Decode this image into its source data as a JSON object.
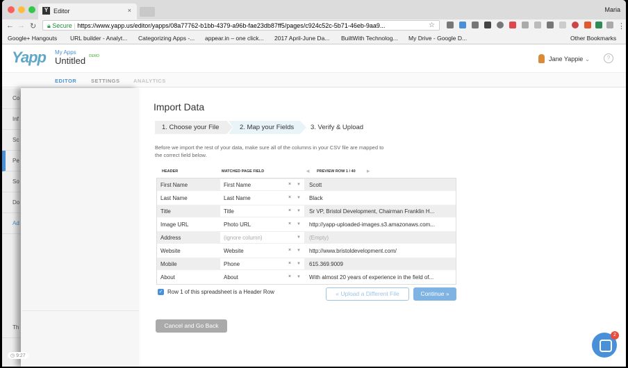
{
  "browser": {
    "tab_title": "Editor",
    "user": "Maria",
    "secure_label": "Secure",
    "url": "https://www.yapp.us/editor/yapps/08a77762-b1bb-4379-a96b-fae23db87ff5/pages/c924c52c-5b71-46eb-9aa9...",
    "bookmarks": [
      "Google+ Hangouts",
      "URL builder - Analyt...",
      "Categorizing Apps -...",
      "appear.in – one click...",
      "2017 April-June Da...",
      "BuiltWith Technolog...",
      "My Drive - Google D..."
    ],
    "other_bookmarks": "Other Bookmarks"
  },
  "app": {
    "logo": "Yapp",
    "my_apps": "My Apps",
    "app_name": "Untitled",
    "demo": "DEMO",
    "user": "Jane Yappie",
    "help": "?"
  },
  "nav": [
    "EDITOR",
    "SETTINGS",
    "ANALYTICS"
  ],
  "sidebar": [
    "Co",
    "Inf",
    "Sc",
    "Pe",
    "So",
    "Do",
    "Ad",
    "Th"
  ],
  "time": "9:27",
  "import": {
    "title": "Import Data",
    "steps": [
      "1. Choose your File",
      "2. Map your Fields",
      "3. Verify & Upload"
    ],
    "intro": "Before we import the rest of your data, make sure all of the columns in your CSV file are mapped to the correct field below.",
    "col_header": "HEADER",
    "col_matched": "MATCHED PAGE FIELD",
    "col_preview": "PREVIEW ROW 1 / 40",
    "rows": [
      {
        "header": "First Name",
        "field": "First Name",
        "preview": "Scott"
      },
      {
        "header": "Last Name",
        "field": "Last Name",
        "preview": "Black"
      },
      {
        "header": "Title",
        "field": "Title",
        "preview": "Sr VP, Bristol Development, Chairman Franklin H..."
      },
      {
        "header": "Image URL",
        "field": "Photo URL",
        "preview": "http://yapp-uploaded-images.s3.amazonaws.com..."
      },
      {
        "header": "Address",
        "field": "(ignore column)",
        "preview": "(Empty)"
      },
      {
        "header": "Website",
        "field": "Website",
        "preview": "http://www.bristoldevelopment.com/"
      },
      {
        "header": "Mobile",
        "field": "Phone",
        "preview": "615.369.9009"
      },
      {
        "header": "About",
        "field": "About",
        "preview": "With almost 20 years of experience in the field of..."
      }
    ],
    "header_row_label": "Row 1 of this spreadsheet is a Header Row",
    "header_row_checked": true,
    "upload_different": "« Upload a Different File",
    "continue": "Continue »",
    "cancel": "Cancel and Go Back"
  },
  "chat_badge": "2"
}
